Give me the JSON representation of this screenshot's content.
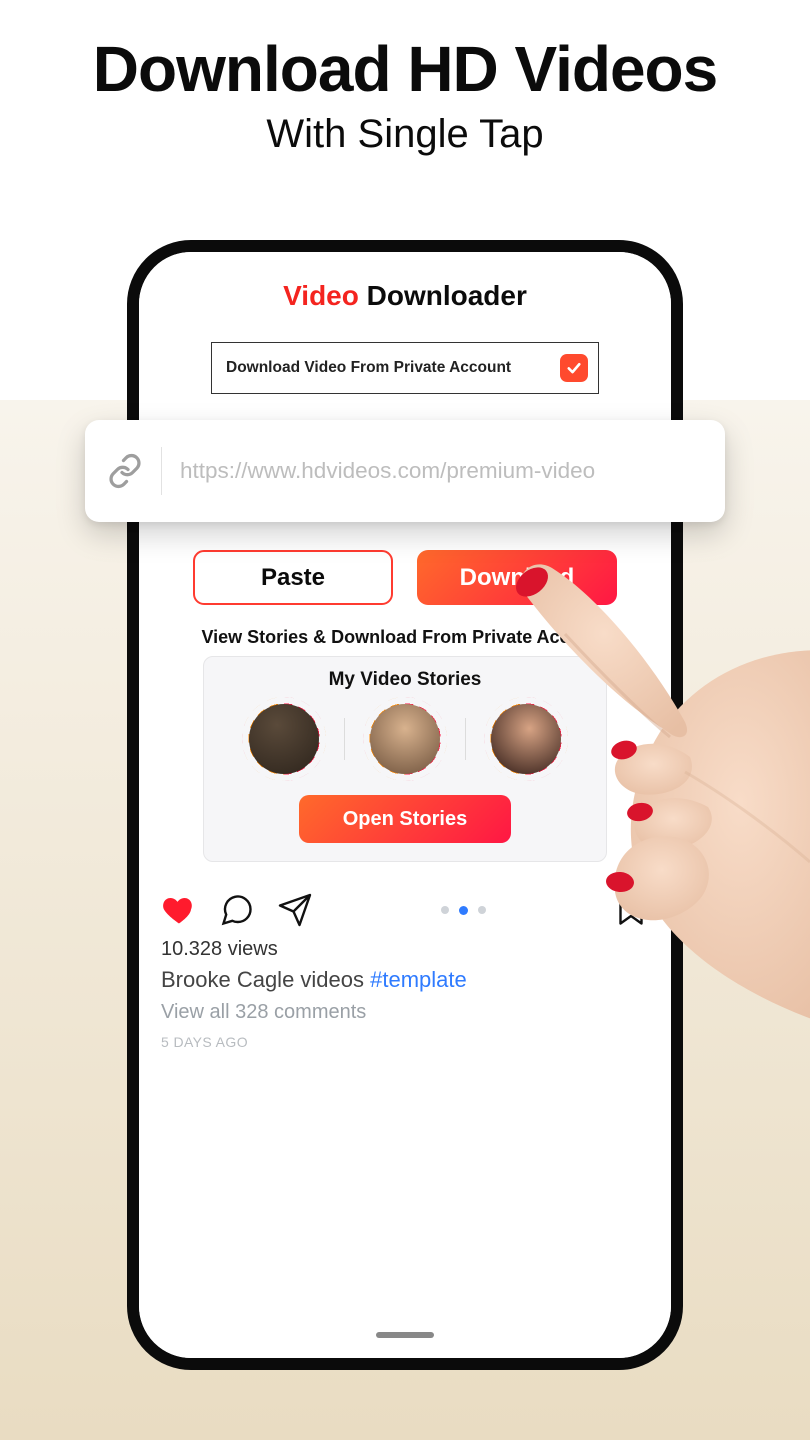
{
  "headline": {
    "title": "Download HD Videos",
    "subtitle": "With Single Tap"
  },
  "app": {
    "title_red": "Video",
    "title_black": " Downloader"
  },
  "private_row": {
    "label": "Download Video From Private Account"
  },
  "url": {
    "placeholder": "https://www.hdvideos.com/premium-video"
  },
  "buttons": {
    "paste": "Paste",
    "download": "Download"
  },
  "stories": {
    "caption": "View Stories & Download From Private Account",
    "card_title": "My Video Stories",
    "open": "Open Stories"
  },
  "post": {
    "views_label": "10.328 views",
    "caption_text": "Brooke Cagle videos ",
    "caption_tag": "#template",
    "comments": "View all 328 comments",
    "timestamp": "5 DAYS AGO"
  }
}
